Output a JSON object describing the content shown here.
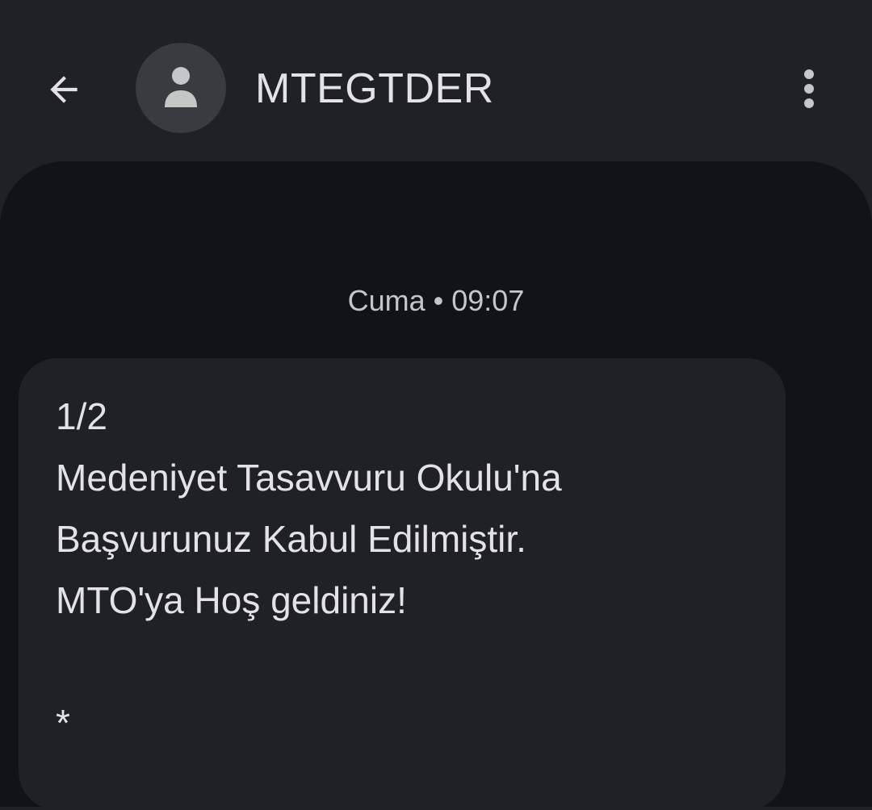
{
  "header": {
    "contact_name": "MTEGTDER",
    "back_icon": "arrow-left-icon",
    "avatar_icon": "person-icon",
    "more_icon": "more-vert-icon"
  },
  "conversation": {
    "timestamp": "Cuma • 09:07",
    "message": {
      "lines": [
        "1/2",
        "Medeniyet Tasavvuru Okulu'na",
        "Başvurunuz Kabul Edilmiştir.",
        "MTO'ya Hoş geldiniz!",
        "",
        "*"
      ]
    }
  },
  "colors": {
    "app_bar_bg": "#1f2124",
    "conversation_bg": "#121316",
    "bubble_bg": "#1f2124",
    "text_primary": "#e3e3e3",
    "text_secondary": "#c4c7c5",
    "avatar_bg": "#393b3e"
  }
}
